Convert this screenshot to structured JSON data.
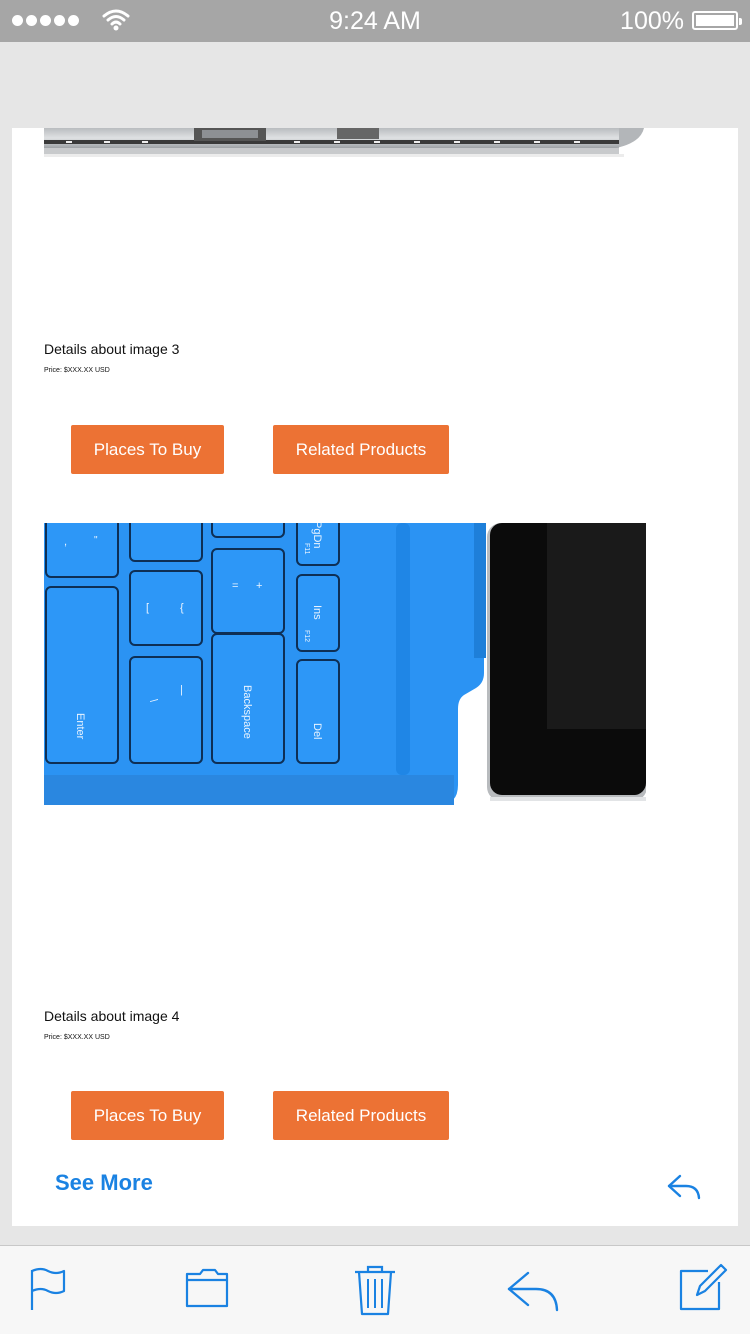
{
  "status_bar": {
    "time": "9:24 AM",
    "battery": "100%"
  },
  "products": [
    {
      "details": "Details about image 3",
      "price": "Price: $XXX.XX USD",
      "buy_label": "Places To Buy",
      "related_label": "Related Products"
    },
    {
      "details": "Details about image 4",
      "price": "Price: $XXX.XX USD",
      "buy_label": "Places To Buy",
      "related_label": "Related Products"
    }
  ],
  "keyboard_keys": {
    "pgdn": "PgDn",
    "f11": "F11",
    "ins": "Ins",
    "f12": "F12",
    "backspace": "Backspace",
    "enter": "Enter",
    "del": "Del"
  },
  "see_more_label": "See More",
  "colors": {
    "accent_orange": "#ec7234",
    "link_blue": "#1a82e2",
    "keyboard_blue": "#2b93f3"
  },
  "toolbar": {
    "icons": [
      "flag-icon",
      "folder-icon",
      "trash-icon",
      "reply-icon",
      "compose-icon"
    ]
  }
}
